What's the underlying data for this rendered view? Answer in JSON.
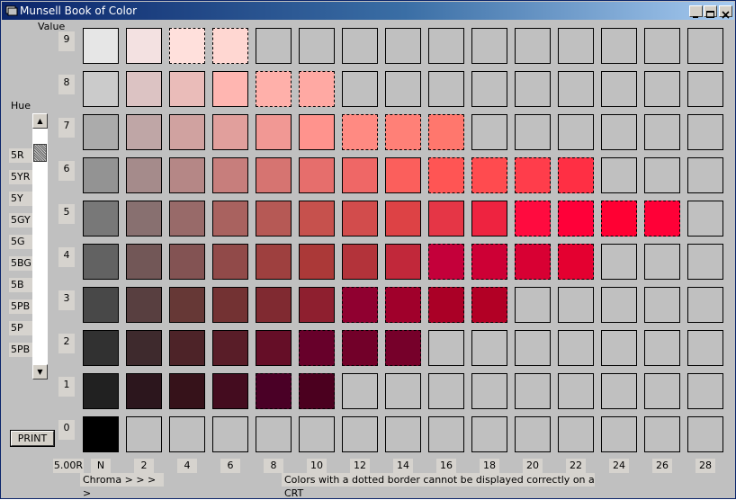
{
  "window": {
    "title": "Munsell Book of Color",
    "minimize_label": "_",
    "maximize_label": "□",
    "close_label": "✕"
  },
  "labels": {
    "value": "Value",
    "hue": "Hue",
    "hue_value": "5.00R",
    "chroma": "Chroma > > > >",
    "note": "Colors with a dotted border cannot be displayed correctly on a CRT"
  },
  "print_label": "PRINT",
  "hue_list": [
    "5R",
    "5YR",
    "5Y",
    "5GY",
    "5G",
    "5BG",
    "5B",
    "5PB",
    "5P",
    "5PB"
  ],
  "value_labels": [
    "9",
    "8",
    "7",
    "6",
    "5",
    "4",
    "3",
    "2",
    "1",
    "0"
  ],
  "chroma_labels": [
    "N",
    "2",
    "4",
    "6",
    "8",
    "10",
    "12",
    "14",
    "16",
    "18",
    "20",
    "22",
    "24",
    "26",
    "28"
  ],
  "scrollbar": {
    "up": "▲",
    "down": "▼"
  },
  "empty_color": "#c0c0c0",
  "rows": [
    {
      "value": 9,
      "colors": [
        "#e6e6e6",
        "#f3e1e1",
        "#ffe0dc",
        "#ffd7d2"
      ],
      "dotted": [
        2,
        3
      ]
    },
    {
      "value": 8,
      "colors": [
        "#cbcbcb",
        "#dcc3c3",
        "#eabcb9",
        "#ffb6b1",
        "#ffb0aa",
        "#ffa9a3"
      ],
      "dotted": [
        4,
        5
      ]
    },
    {
      "value": 7,
      "colors": [
        "#ababab",
        "#bfa6a6",
        "#d0a2a0",
        "#e19f9c",
        "#f19894",
        "#ff938d",
        "#ff8a82",
        "#ff8077",
        "#ff776d"
      ],
      "dotted": [
        6,
        7,
        8
      ]
    },
    {
      "value": 6,
      "colors": [
        "#939393",
        "#a58b8b",
        "#b58786",
        "#c77e7c",
        "#d67471",
        "#e66e6c",
        "#ef6766",
        "#fb5f5c",
        "#ff5554",
        "#ff4b4f",
        "#ff3d4b",
        "#ff2f44"
      ],
      "dotted": [
        8,
        9,
        10,
        11
      ]
    },
    {
      "value": 5,
      "colors": [
        "#787878",
        "#887070",
        "#986a69",
        "#a9625f",
        "#b65955",
        "#c6514d",
        "#d24c4c",
        "#dd4245",
        "#e53646",
        "#ee2340",
        "#ff0b3f",
        "#ff0039",
        "#ff0033",
        "#ff0037"
      ],
      "dotted": [
        10,
        11,
        12,
        13
      ]
    },
    {
      "value": 4,
      "colors": [
        "#626262",
        "#725757",
        "#835353",
        "#914a49",
        "#9e403f",
        "#ab3938",
        "#b3333a",
        "#c1283a",
        "#c4003a",
        "#cd0035",
        "#d80033",
        "#e40030"
      ],
      "dotted": [
        8,
        9,
        10,
        11
      ]
    },
    {
      "value": 3,
      "colors": [
        "#484848",
        "#583f40",
        "#663836",
        "#733233",
        "#802a31",
        "#8e1f2f",
        "#900030",
        "#a0002b",
        "#aa0026",
        "#b20025"
      ],
      "dotted": [
        6,
        7,
        8,
        9
      ]
    },
    {
      "value": 2,
      "colors": [
        "#313131",
        "#3e2a2d",
        "#4d2328",
        "#591d28",
        "#650e27",
        "#67002a",
        "#720029",
        "#76002a"
      ],
      "dotted": [
        5,
        6,
        7
      ]
    },
    {
      "value": 1,
      "colors": [
        "#212121",
        "#2c161d",
        "#36121a",
        "#440c1f",
        "#4a0026",
        "#4b001f"
      ],
      "dotted": [
        4,
        5
      ]
    },
    {
      "value": 0,
      "colors": [
        "#000000"
      ],
      "dotted": []
    }
  ]
}
